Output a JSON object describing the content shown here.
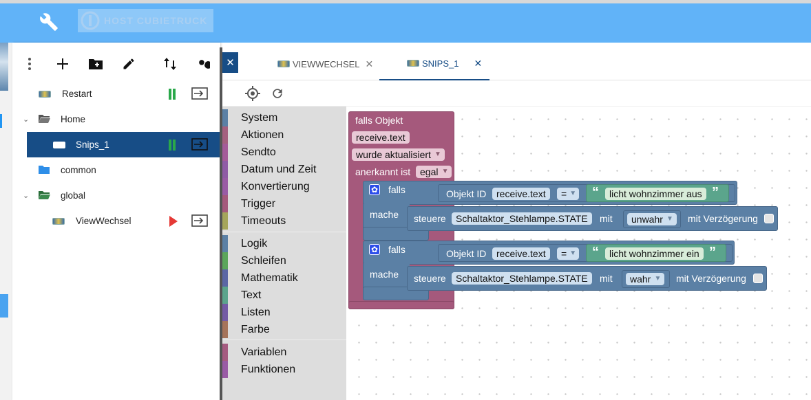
{
  "app": {
    "host_label": "HOST CUBIETRUCK",
    "wrench_icon": "wrench-icon",
    "accent": "#61b3f8",
    "selected_color": "#174d86"
  },
  "sidebar": {
    "toolbar": [
      "menu-dots-icon",
      "add-icon",
      "add-folder-icon",
      "edit-icon",
      "sort-icon",
      "search-icon"
    ],
    "tree": [
      {
        "label": "Restart",
        "type": "script",
        "status": "paused"
      },
      {
        "label": "Home",
        "type": "folder-open"
      },
      {
        "label": "Snips_1",
        "type": "script",
        "status": "paused",
        "selected": true
      },
      {
        "label": "common",
        "type": "folder"
      },
      {
        "label": "global",
        "type": "folder-open"
      },
      {
        "label": "ViewWechsel",
        "type": "script",
        "status": "stopped"
      }
    ]
  },
  "tabs": [
    {
      "label": "VIEWWECHSEL",
      "active": false
    },
    {
      "label": "SNIPS_1",
      "active": true
    }
  ],
  "editor_toolbar": [
    "target-icon",
    "refresh-icon"
  ],
  "toolbox": {
    "categories": [
      {
        "label": "System",
        "color": "#5b80a5"
      },
      {
        "label": "Aktionen",
        "color": "#a5607f"
      },
      {
        "label": "Sendto",
        "color": "#a55b99"
      },
      {
        "label": "Datum und Zeit",
        "color": "#8f5ba5"
      },
      {
        "label": "Konvertierung",
        "color": "#9a5ba5"
      },
      {
        "label": "Trigger",
        "color": "#a5597c"
      },
      {
        "label": "Timeouts",
        "color": "#a5a55b"
      },
      {
        "label": "Logik",
        "color": "#5b80a5"
      },
      {
        "label": "Schleifen",
        "color": "#5ba55b"
      },
      {
        "label": "Mathematik",
        "color": "#5b67a5"
      },
      {
        "label": "Text",
        "color": "#5ba58c"
      },
      {
        "label": "Listen",
        "color": "#745ba5"
      },
      {
        "label": "Farbe",
        "color": "#a5745b"
      },
      {
        "label": "Variablen",
        "color": "#a55b80"
      },
      {
        "label": "Funktionen",
        "color": "#995ba5"
      }
    ]
  },
  "blocks": {
    "trigger": {
      "title": "falls Objekt",
      "object": "receive.text",
      "event": "wurde aktualisiert",
      "ack_label": "anerkannt ist",
      "ack_value": "egal"
    },
    "if1": {
      "falls": "falls",
      "mache": "mache",
      "obj_label": "Objekt ID",
      "obj": "receive.text",
      "op": "=",
      "text": "licht wohnzimmer aus",
      "action_label": "steuere",
      "target": "Schaltaktor_Stehlampe.STATE",
      "mit": "mit",
      "value": "unwahr",
      "delay_label": "mit Verzögerung"
    },
    "if2": {
      "falls": "falls",
      "mache": "mache",
      "obj_label": "Objekt ID",
      "obj": "receive.text",
      "op": "=",
      "text": "licht wohnzimmer ein",
      "action_label": "steuere",
      "target": "Schaltaktor_Stehlampe.STATE",
      "mit": "mit",
      "value": "wahr",
      "delay_label": "mit Verzögerung"
    },
    "colors": {
      "trigger": "#a5597c",
      "logic": "#5b80a5",
      "text": "#5ba58c"
    }
  }
}
